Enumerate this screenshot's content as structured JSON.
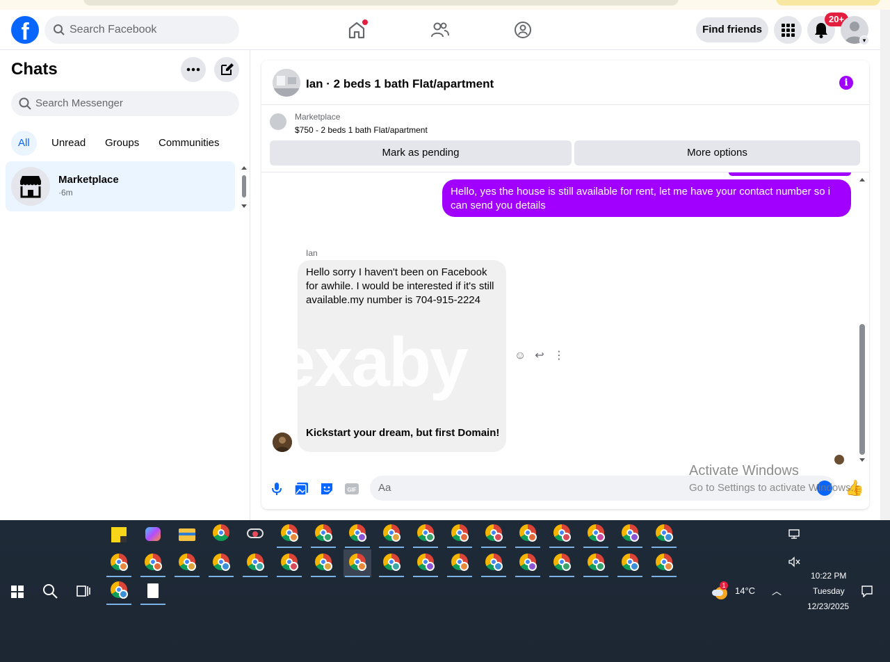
{
  "header": {
    "search_placeholder": "Search Facebook",
    "find_friends_label": "Find friends",
    "notifications_badge": "20+"
  },
  "sidebar": {
    "title": "Chats",
    "search_placeholder": "Search Messenger",
    "filters": [
      "All",
      "Unread",
      "Groups",
      "Communities"
    ],
    "active_filter": "All",
    "chats": [
      {
        "name": "Marketplace",
        "time": "·6m"
      }
    ]
  },
  "conversation": {
    "title": "Ian · 2 beds 1 bath Flat/apartment",
    "marketplace_label": "Marketplace",
    "listing": "$750 - 2 beds 1 bath Flat/apartment",
    "mark_pending_label": "Mark as pending",
    "more_options_label": "More options",
    "outgoing_message": "Hello, yes the house is still available for rent, let me have your contact number so i can send you details",
    "sender_name": "Ian",
    "incoming_message": "Hello sorry I haven't been on Facebook for awhile. I would be interested if it's still available.my number is 704-915-2224",
    "watermark_text": "exaby",
    "ad_text": "Kickstart your dream, but first Domain!",
    "composer_placeholder": "Aa",
    "accent_color": "#a100ff"
  },
  "activation": {
    "line1": "Activate Windows",
    "line2": "Go to Settings to activate Windows."
  },
  "taskbar": {
    "weather": "14°C",
    "weather_badge": "1",
    "time": "10:22 PM",
    "day": "Tuesday",
    "date": "12/23/2025"
  }
}
